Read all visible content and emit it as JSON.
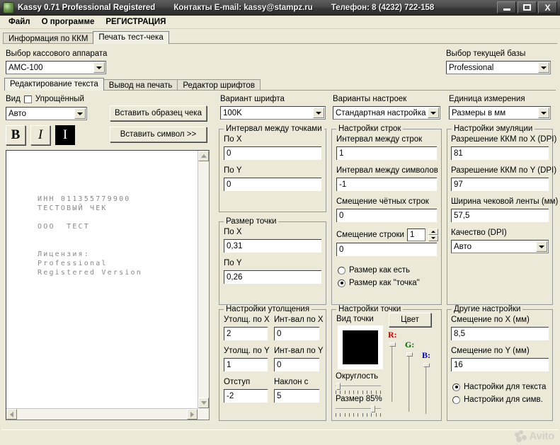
{
  "window": {
    "title": "Kassy 0.71 Professional Registered",
    "contacts": "Контакты E-mail: kassy@stampz.ru",
    "phone": "Телефон: 8 (4232) 722-158",
    "minimize_label": "Minimize",
    "maximize_label": "Maximize",
    "close_label": "X"
  },
  "menu": {
    "items": [
      {
        "label": "Файл"
      },
      {
        "label": "О программе"
      },
      {
        "label": "РЕГИСТРАЦИЯ"
      }
    ]
  },
  "main_tabs": [
    {
      "label": "Информация по ККМ",
      "active": false
    },
    {
      "label": "Печать тест-чека",
      "active": true
    }
  ],
  "device": {
    "label": "Выбор кассового аппарата",
    "value": "АМС-100"
  },
  "database": {
    "label": "Выбор текущей базы",
    "value": "Professional"
  },
  "sub_tabs": [
    {
      "label": "Редактирование текста",
      "active": true
    },
    {
      "label": "Вывод на печать",
      "active": false
    },
    {
      "label": "Редактор шрифтов",
      "active": false
    }
  ],
  "view": {
    "label": "Вид",
    "simplified_label": "Упрощённый",
    "simplified_checked": false,
    "mode_value": "Авто",
    "bold_label": "B",
    "italic_label": "I",
    "invert_label": "I"
  },
  "actions": {
    "insert_sample": "Вставить образец чека",
    "insert_symbol": "Вставить символ >>"
  },
  "receipt_preview": {
    "lines": [
      "ИНН 011355779900",
      "ТЕСТОВЫЙ ЧЕК",
      "",
      "ООО  ТЕСТ",
      "",
      "",
      "Лицензия:",
      "Professional",
      "Registered Version"
    ]
  },
  "font_variant": {
    "label": "Вариант шрифта",
    "value": "100K"
  },
  "settings_variant": {
    "label": "Варианты настроек",
    "value": "Стандартная настройка"
  },
  "unit": {
    "label": "Единица измерения",
    "value": "Размеры в мм"
  },
  "dot_interval": {
    "title": "Интервал между точками",
    "x_label": "По X",
    "x_value": "0",
    "y_label": "По Y",
    "y_value": "0"
  },
  "dot_size": {
    "title": "Размер точки",
    "x_label": "По X",
    "x_value": "0,31",
    "y_label": "По Y",
    "y_value": "0,26"
  },
  "line_settings": {
    "title": "Настройки строк",
    "line_interval_label": "Интервал между строк",
    "line_interval_value": "1",
    "char_interval_label": "Интервал между символов",
    "char_interval_value": "-1",
    "even_offset_label": "Смещение чётных строк",
    "even_offset_value": "0",
    "line_offset_label": "Смещение строки",
    "line_offset_spin": "1",
    "line_offset_value": "0",
    "radio_as_is": "Размер как есть",
    "radio_as_dot": "Размер как \"точка\"",
    "radio_selected": "as_dot"
  },
  "emulation": {
    "title": "Настройки эмуляции",
    "dpi_x_label": "Разрешение ККМ по X (DPI)",
    "dpi_x_value": "81",
    "dpi_y_label": "Разрешение ККМ по Y (DPI)",
    "dpi_y_value": "97",
    "width_label": "Ширина чековой ленты (мм)",
    "width_value": "57,5",
    "quality_label": "Качество (DPI)",
    "quality_value": "Авто"
  },
  "thickening": {
    "title": "Настройки утолщения",
    "thick_x_label": "Утолщ. по X",
    "thick_x_value": "2",
    "int_x_label": "Инт-вал по X",
    "int_x_value": "0",
    "thick_y_label": "Утолщ. по Y",
    "thick_y_value": "1",
    "int_y_label": "Инт-вал по Y",
    "int_y_value": "0",
    "indent_label": "Отступ",
    "indent_value": "-2",
    "slant_label": "Наклон с",
    "slant_value": "5"
  },
  "dot_settings": {
    "title": "Настройки точки",
    "dot_view_label": "Вид точки",
    "color_button": "Цвет",
    "dot_color": "#000000",
    "r_label": "R:",
    "g_label": "G:",
    "b_label": "B:",
    "r_color": "#cc0000",
    "g_color": "#006600",
    "b_color": "#0000cc",
    "roundness_label": "Округлость",
    "size_label": "Размер 85%"
  },
  "other_settings": {
    "title": "Другие настройки",
    "offset_x_label": "Смещение по X (мм)",
    "offset_x_value": "8,5",
    "offset_y_label": "Смещение по Y (мм)",
    "offset_y_value": "16",
    "radio_text": "Настройки для текста",
    "radio_symbol": "Настройки для симв.",
    "radio_selected": "text"
  },
  "watermark": {
    "text": "Avito"
  }
}
